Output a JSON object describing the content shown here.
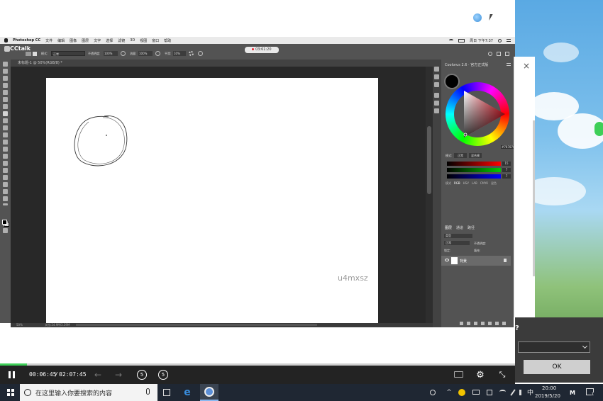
{
  "mac_menubar": {
    "items": [
      "Photoshop CC",
      "文件",
      "编辑",
      "图像",
      "图层",
      "文字",
      "选择",
      "滤镜",
      "3D",
      "视图",
      "窗口",
      "帮助"
    ],
    "clock": "周日 下午7:37"
  },
  "cctalk": {
    "logo": "CCtalk",
    "recording_time": "03:61:20"
  },
  "ps": {
    "doc_tab": "未标题-1 @ 50%(RGB/8) *",
    "options": {
      "mode_label": "模式:",
      "mode_value": "正常",
      "opacity_label": "不透明度:",
      "opacity_value": "100%",
      "flow_label": "流量:",
      "flow_value": "100%",
      "smooth_label": "平滑:",
      "smooth_value": "10%"
    },
    "status": {
      "zoom": "50%",
      "doc": "文档:24.9M/3.39M"
    },
    "watermark": "u4mxsz"
  },
  "coolorus": {
    "title": "Coolorus 2.6 · 官方正式版",
    "hex": "#787878",
    "mode_label": "模式:",
    "mode_normal": "正常",
    "mode_mix": "混合模",
    "rgb": [
      15,
      7,
      7
    ],
    "tabs": [
      "模式",
      "RGB",
      "HSV",
      "LAB",
      "CMYK",
      "混色"
    ]
  },
  "layers": {
    "tabs": [
      "图层",
      "通道",
      "路径"
    ],
    "kind_label": "类型",
    "mode": "正常",
    "opacity_label": "不透明度:",
    "lock_label": "锁定:",
    "fill_label": "填充:",
    "layer_name": "背景"
  },
  "player": {
    "current_time": "00:06:45",
    "separator": "/",
    "total_time": "02:07:45",
    "progress_fraction": 0.052,
    "skip_back": "5",
    "skip_forward": "5"
  },
  "dialog": {
    "question_suffix": "?",
    "ok_label": "OK"
  },
  "taskbar": {
    "search_placeholder": "在这里输入你要搜索的内容",
    "ime": "中",
    "time": "20:00",
    "date": "2019/5/20",
    "notif_count": "1"
  }
}
